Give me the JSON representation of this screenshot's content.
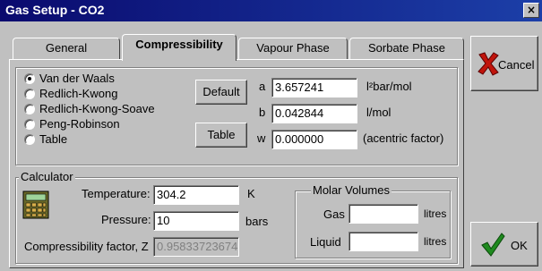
{
  "window": {
    "title": "Gas Setup - CO2",
    "close_glyph": "×"
  },
  "tabs": [
    {
      "label": "General",
      "active": false
    },
    {
      "label": "Compressibility",
      "active": true
    },
    {
      "label": "Vapour Phase",
      "active": false
    },
    {
      "label": "Sorbate Phase",
      "active": false
    }
  ],
  "eos": {
    "options": [
      "Van der Waals",
      "Redlich-Kwong",
      "Redlich-Kwong-Soave",
      "Peng-Robinson",
      "Table"
    ],
    "selected": "Van der Waals",
    "default_button": "Default",
    "table_button": "Table"
  },
  "params": {
    "a": {
      "label": "a",
      "value": "3.657241",
      "unit": "l²bar/mol"
    },
    "b": {
      "label": "b",
      "value": "0.042844",
      "unit": "l/mol"
    },
    "w": {
      "label": "w",
      "value": "0.000000",
      "unit": "(acentric factor)"
    }
  },
  "calculator": {
    "title": "Calculator",
    "temperature_label": "Temperature:",
    "temperature_value": "304.2",
    "temperature_unit": "K",
    "pressure_label": "Pressure:",
    "pressure_value": "10",
    "pressure_unit": "bars",
    "z_label": "Compressibility factor, Z",
    "z_value": "0.95833723674",
    "molar_title": "Molar Volumes",
    "gas_label": "Gas",
    "gas_value": "",
    "gas_unit": "litres",
    "liquid_label": "Liquid",
    "liquid_value": "",
    "liquid_unit": "litres"
  },
  "side_buttons": {
    "cancel": "Cancel",
    "ok": "OK"
  },
  "icons": {
    "calculator": "calculator-icon",
    "cancel": "red-x-icon",
    "ok": "green-check-icon"
  },
  "colors": {
    "title_start": "#0a0a6e",
    "title_end": "#1c3fa8",
    "cancel_x": "#c0140c",
    "ok_check": "#1f8a1f"
  }
}
